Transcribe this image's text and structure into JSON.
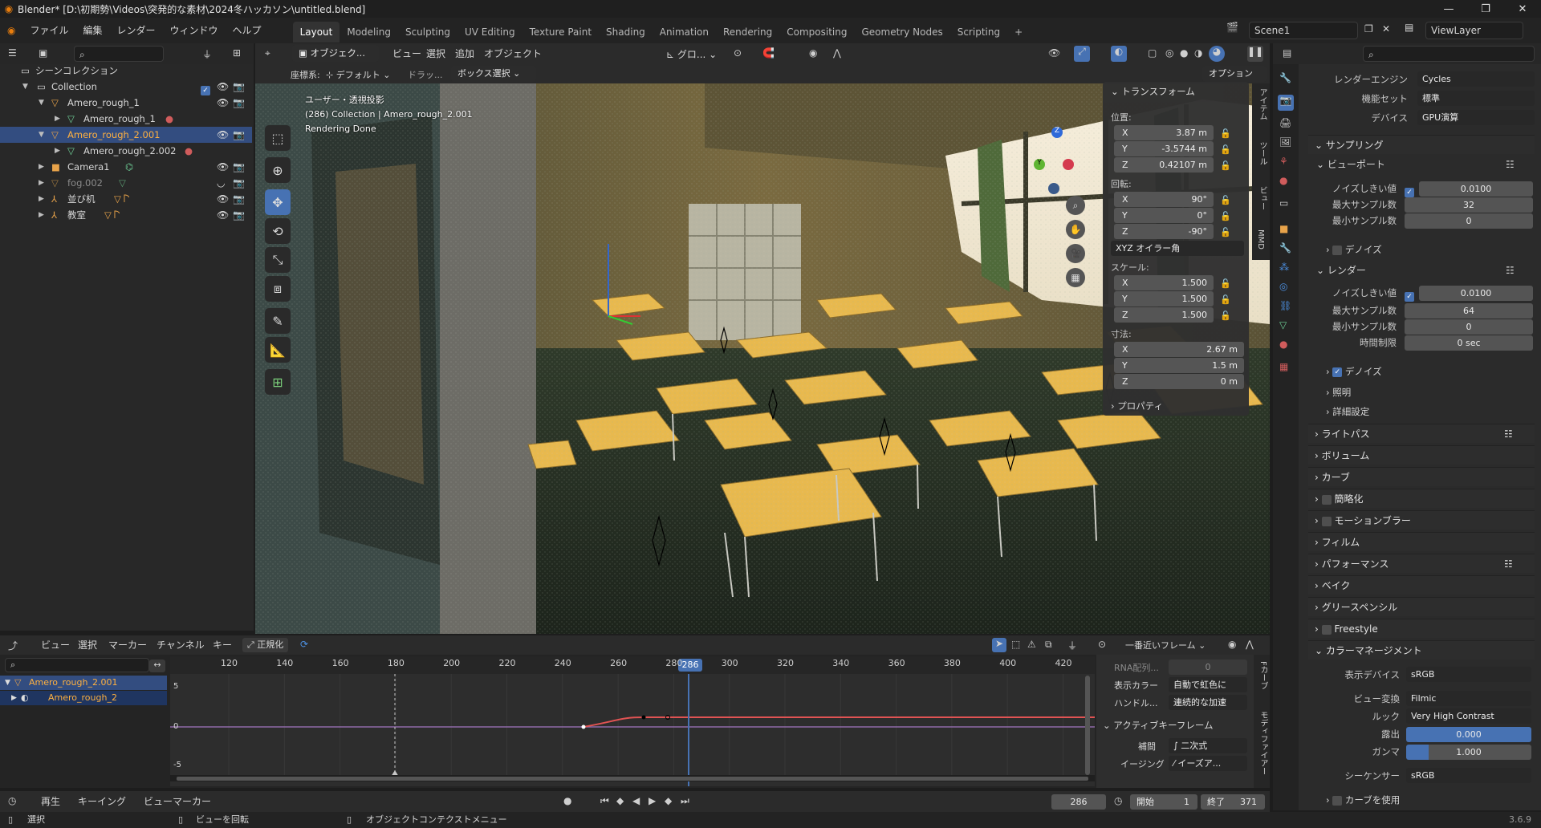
{
  "window": {
    "title": "Blender* [D:\\初期勢\\Videos\\突発的な素材\\2024冬ハッカソン\\untitled.blend]"
  },
  "menu": [
    "ファイル",
    "編集",
    "レンダー",
    "ウィンドウ",
    "ヘルプ"
  ],
  "workspaces": [
    "Layout",
    "Modeling",
    "Sculpting",
    "UV Editing",
    "Texture Paint",
    "Shading",
    "Animation",
    "Rendering",
    "Compositing",
    "Geometry Nodes",
    "Scripting"
  ],
  "workspace_add": "+",
  "scene": {
    "name": "Scene1",
    "viewlayer": "ViewLayer"
  },
  "outliner": {
    "root": "シーンコレクション",
    "rows": [
      {
        "label": "Collection"
      },
      {
        "label": "Amero_rough_1"
      },
      {
        "label": "Amero_rough_1"
      },
      {
        "label": "Amero_rough_2.001"
      },
      {
        "label": "Amero_rough_2.002"
      },
      {
        "label": "Camera1"
      },
      {
        "label": "fog.002"
      },
      {
        "label": "並び机"
      },
      {
        "label": "教室"
      }
    ]
  },
  "viewport": {
    "mode": "オブジェク...",
    "menus": [
      "ビュー",
      "選択",
      "追加",
      "オブジェクト"
    ],
    "transform_orient": "グロ...",
    "coord_label": "座標系:",
    "coord_value": "デフォルト",
    "drag_label": "ドラッ...",
    "select_mode": "ボックス選択",
    "options": "オプション",
    "overlay_text": [
      "ユーザー・透視投影",
      "(286) Collection | Amero_rough_2.001",
      "Rendering Done"
    ],
    "side_tabs": [
      "アイテム",
      "ツール",
      "ビュー",
      "MMD"
    ]
  },
  "transform_panel": {
    "title": "トランスフォーム",
    "location_label": "位置:",
    "location": [
      {
        "axis": "X",
        "value": "3.87 m"
      },
      {
        "axis": "Y",
        "value": "-3.5744 m"
      },
      {
        "axis": "Z",
        "value": "0.42107 m"
      }
    ],
    "rotation_label": "回転:",
    "rotation": [
      {
        "axis": "X",
        "value": "90°"
      },
      {
        "axis": "Y",
        "value": "0°"
      },
      {
        "axis": "Z",
        "value": "-90°"
      }
    ],
    "rotation_mode": "XYZ オイラー角",
    "scale_label": "スケール:",
    "scale": [
      {
        "axis": "X",
        "value": "1.500"
      },
      {
        "axis": "Y",
        "value": "1.500"
      },
      {
        "axis": "Z",
        "value": "1.500"
      }
    ],
    "dimensions_label": "寸法:",
    "dimensions": [
      {
        "axis": "X",
        "value": "2.67 m"
      },
      {
        "axis": "Y",
        "value": "1.5 m"
      },
      {
        "axis": "Z",
        "value": "0 m"
      }
    ],
    "properties": "プロパティ"
  },
  "graph_editor": {
    "menus": [
      "ビュー",
      "選択",
      "マーカー",
      "チャンネル",
      "キー"
    ],
    "normalize": "正規化",
    "snap": "一番近いフレーム",
    "ticks": [
      "120",
      "140",
      "160",
      "180",
      "200",
      "220",
      "240",
      "260",
      "280",
      "300",
      "320",
      "340",
      "360",
      "380",
      "400",
      "420"
    ],
    "current_frame": "286",
    "y_labels": [
      "5",
      "0",
      "-5"
    ],
    "channels": [
      "Amero_rough_2.001",
      "Amero_rough_2"
    ],
    "sidebar": {
      "rna": "RNA配列...",
      "rna_value": "0",
      "display_color_label": "表示カラー",
      "display_color": "自動で虹色に",
      "handle_label": "ハンドル...",
      "handle": "連続的な加速",
      "active_kf": "アクティブキーフレーム",
      "interp_label": "補間",
      "interp": "二次式",
      "easing_label": "イージング",
      "easing": "イーズア..."
    },
    "side_tabs": [
      "Fカーブ",
      "モディファイアー"
    ]
  },
  "timeline": {
    "menus": [
      "再生",
      "キーイング",
      "ビュー",
      "マーカー"
    ],
    "frame": "286",
    "start_label": "開始",
    "start": "1",
    "end_label": "終了",
    "end": "371"
  },
  "statusbar": {
    "items": [
      "選択",
      "ビューを回転",
      "オブジェクトコンテクストメニュー"
    ],
    "version": "3.6.9"
  },
  "render_props": {
    "engine_label": "レンダーエンジン",
    "engine": "Cycles",
    "feature_label": "機能セット",
    "feature": "標準",
    "device_label": "デバイス",
    "device": "GPU演算",
    "sampling": "サンプリング",
    "viewport": "ビューポート",
    "vp_noise_label": "ノイズしきい値",
    "vp_noise": "0.0100",
    "vp_max_label": "最大サンプル数",
    "vp_max": "32",
    "vp_min_label": "最小サンプル数",
    "vp_min": "0",
    "denoise": "デノイズ",
    "render": "レンダー",
    "r_noise_label": "ノイズしきい値",
    "r_noise": "0.0100",
    "r_max_label": "最大サンプル数",
    "r_max": "64",
    "r_min_label": "最小サンプル数",
    "r_min": "0",
    "time_label": "時間制限",
    "time": "0 sec",
    "r_denoise": "デノイズ",
    "lights": "照明",
    "advanced": "詳細設定",
    "sections": [
      "ライトパス",
      "ボリューム",
      "カーブ",
      "簡略化",
      "モーションブラー",
      "フィルム",
      "パフォーマンス",
      "ベイク",
      "グリースペンシル",
      "Freestyle"
    ],
    "color_mgmt": "カラーマネージメント",
    "display_device_label": "表示デバイス",
    "display_device": "sRGB",
    "view_transform_label": "ビュー変換",
    "view_transform": "Filmic",
    "look_label": "ルック",
    "look": "Very High Contrast",
    "exposure_label": "露出",
    "exposure": "0.000",
    "gamma_label": "ガンマ",
    "gamma": "1.000",
    "sequencer_label": "シーケンサー",
    "sequencer": "sRGB",
    "use_curves": "カーブを使用"
  }
}
